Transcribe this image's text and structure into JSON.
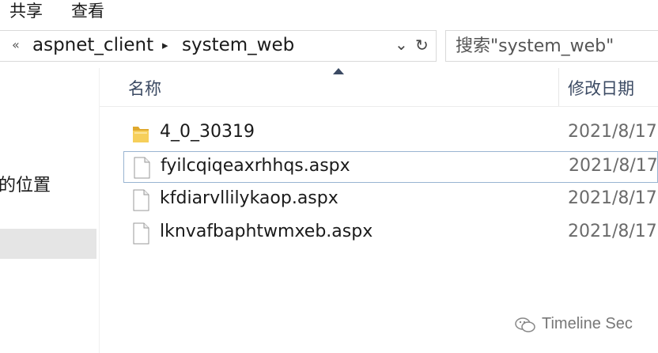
{
  "ribbon": {
    "share_label": "共享",
    "view_label": "查看"
  },
  "address_bar": {
    "overflow_glyph": "«",
    "crumbs": [
      "aspnet_client",
      "system_web"
    ],
    "separator_glyph": "▸",
    "dropdown_glyph": "⌄",
    "refresh_glyph": "↻"
  },
  "search": {
    "placeholder": "搜索\"system_web\""
  },
  "nav": {
    "item_label": "的位置"
  },
  "columns": {
    "name": "名称",
    "date": "修改日期"
  },
  "files": [
    {
      "name": "4_0_30319",
      "date": "2021/8/17",
      "type": "folder-icon"
    },
    {
      "name": "fyilcqiqeaxrhhqs.aspx",
      "date": "2021/8/17",
      "type": "file-icon"
    },
    {
      "name": "kfdiarvllilykaop.aspx",
      "date": "2021/8/17",
      "type": "file-icon"
    },
    {
      "name": "lknvafbaphtwmxeb.aspx",
      "date": "2021/8/17",
      "type": "file-icon"
    }
  ],
  "watermark": {
    "text": "Timeline Sec",
    "icon": "wechat-icon"
  },
  "colors": {
    "header_text": "#3b4a63",
    "focus_border": "#99b4d1",
    "folder": "#f2c94c"
  }
}
